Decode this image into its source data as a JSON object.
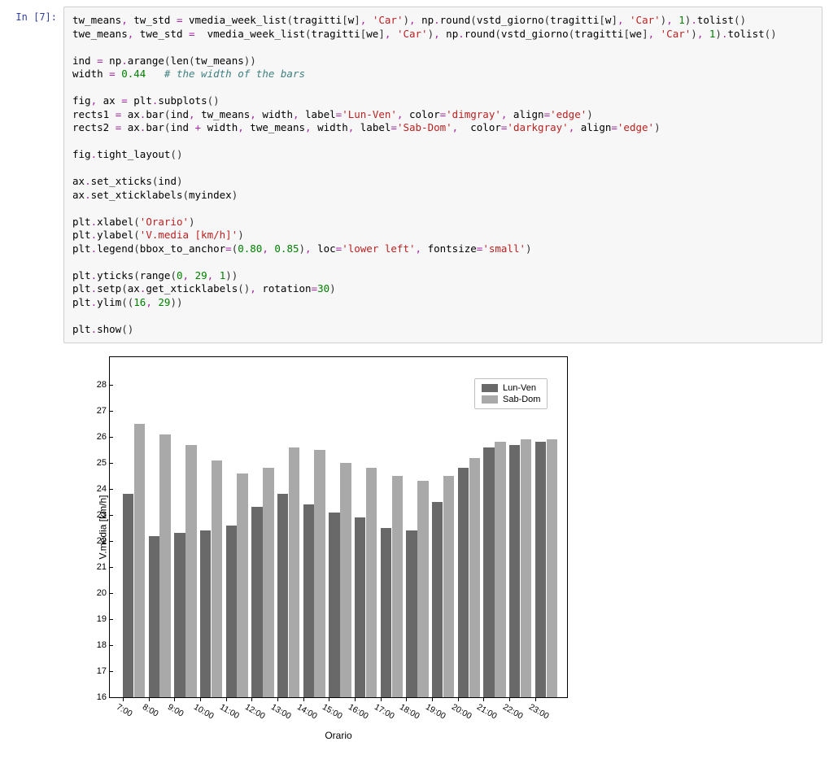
{
  "cell": {
    "prompt": "In [7]:",
    "code_html": "tw_means<span class=\"c-op\">,</span> tw_std <span class=\"c-op\">=</span> vmedia_week_list<span class=\"c-punct\">(</span>tragitti<span class=\"c-punct\">[</span>w<span class=\"c-punct\">]</span><span class=\"c-op\">,</span> <span class=\"c-str\">'Car'</span><span class=\"c-punct\">)</span><span class=\"c-op\">,</span> np<span class=\"c-op\">.</span>round<span class=\"c-punct\">(</span>vstd_giorno<span class=\"c-punct\">(</span>tragitti<span class=\"c-punct\">[</span>w<span class=\"c-punct\">]</span><span class=\"c-op\">,</span> <span class=\"c-str\">'Car'</span><span class=\"c-punct\">)</span><span class=\"c-op\">,</span> <span class=\"c-num\">1</span><span class=\"c-punct\">)</span><span class=\"c-op\">.</span>tolist<span class=\"c-punct\">()</span>\ntwe_means<span class=\"c-op\">,</span> twe_std <span class=\"c-op\">=</span>  vmedia_week_list<span class=\"c-punct\">(</span>tragitti<span class=\"c-punct\">[</span>we<span class=\"c-punct\">]</span><span class=\"c-op\">,</span> <span class=\"c-str\">'Car'</span><span class=\"c-punct\">)</span><span class=\"c-op\">,</span> np<span class=\"c-op\">.</span>round<span class=\"c-punct\">(</span>vstd_giorno<span class=\"c-punct\">(</span>tragitti<span class=\"c-punct\">[</span>we<span class=\"c-punct\">]</span><span class=\"c-op\">,</span> <span class=\"c-str\">'Car'</span><span class=\"c-punct\">)</span><span class=\"c-op\">,</span> <span class=\"c-num\">1</span><span class=\"c-punct\">)</span><span class=\"c-op\">.</span>tolist<span class=\"c-punct\">()</span>\n\nind <span class=\"c-op\">=</span> np<span class=\"c-op\">.</span>arange<span class=\"c-punct\">(</span>len<span class=\"c-punct\">(</span>tw_means<span class=\"c-punct\">))</span>\nwidth <span class=\"c-op\">=</span> <span class=\"c-num\">0.44</span>   <span class=\"c-com\"># the width of the bars</span>\n\nfig<span class=\"c-op\">,</span> ax <span class=\"c-op\">=</span> plt<span class=\"c-op\">.</span>subplots<span class=\"c-punct\">()</span>\nrects1 <span class=\"c-op\">=</span> ax<span class=\"c-op\">.</span>bar<span class=\"c-punct\">(</span>ind<span class=\"c-op\">,</span> tw_means<span class=\"c-op\">,</span> width<span class=\"c-op\">,</span> label<span class=\"c-op\">=</span><span class=\"c-str\">'Lun-Ven'</span><span class=\"c-op\">,</span> color<span class=\"c-op\">=</span><span class=\"c-str\">'dimgray'</span><span class=\"c-op\">,</span> align<span class=\"c-op\">=</span><span class=\"c-str\">'edge'</span><span class=\"c-punct\">)</span>\nrects2 <span class=\"c-op\">=</span> ax<span class=\"c-op\">.</span>bar<span class=\"c-punct\">(</span>ind <span class=\"c-op\">+</span> width<span class=\"c-op\">,</span> twe_means<span class=\"c-op\">,</span> width<span class=\"c-op\">,</span> label<span class=\"c-op\">=</span><span class=\"c-str\">'Sab-Dom'</span><span class=\"c-op\">,</span>  color<span class=\"c-op\">=</span><span class=\"c-str\">'darkgray'</span><span class=\"c-op\">,</span> align<span class=\"c-op\">=</span><span class=\"c-str\">'edge'</span><span class=\"c-punct\">)</span>\n\nfig<span class=\"c-op\">.</span>tight_layout<span class=\"c-punct\">()</span>\n\nax<span class=\"c-op\">.</span>set_xticks<span class=\"c-punct\">(</span>ind<span class=\"c-punct\">)</span>\nax<span class=\"c-op\">.</span>set_xticklabels<span class=\"c-punct\">(</span>myindex<span class=\"c-punct\">)</span>\n\nplt<span class=\"c-op\">.</span>xlabel<span class=\"c-punct\">(</span><span class=\"c-str\">'Orario'</span><span class=\"c-punct\">)</span>\nplt<span class=\"c-op\">.</span>ylabel<span class=\"c-punct\">(</span><span class=\"c-str\">'V.media [km/h]'</span><span class=\"c-punct\">)</span>\nplt<span class=\"c-op\">.</span>legend<span class=\"c-punct\">(</span>bbox_to_anchor<span class=\"c-op\">=</span><span class=\"c-punct\">(</span><span class=\"c-num\">0.80</span><span class=\"c-op\">,</span> <span class=\"c-num\">0.85</span><span class=\"c-punct\">)</span><span class=\"c-op\">,</span> loc<span class=\"c-op\">=</span><span class=\"c-str\">'lower left'</span><span class=\"c-op\">,</span> fontsize<span class=\"c-op\">=</span><span class=\"c-str\">'small'</span><span class=\"c-punct\">)</span>\n\nplt<span class=\"c-op\">.</span>yticks<span class=\"c-punct\">(</span>range<span class=\"c-punct\">(</span><span class=\"c-num\">0</span><span class=\"c-op\">,</span> <span class=\"c-num\">29</span><span class=\"c-op\">,</span> <span class=\"c-num\">1</span><span class=\"c-punct\">))</span>\nplt<span class=\"c-op\">.</span>setp<span class=\"c-punct\">(</span>ax<span class=\"c-op\">.</span>get_xticklabels<span class=\"c-punct\">()</span><span class=\"c-op\">,</span> rotation<span class=\"c-op\">=</span><span class=\"c-num\">30</span><span class=\"c-punct\">)</span>\nplt<span class=\"c-op\">.</span>ylim<span class=\"c-punct\">((</span><span class=\"c-num\">16</span><span class=\"c-op\">,</span> <span class=\"c-num\">29</span><span class=\"c-punct\">))</span>\n\nplt<span class=\"c-op\">.</span>show<span class=\"c-punct\">()</span>"
  },
  "chart_data": {
    "type": "bar",
    "xlabel": "Orario",
    "ylabel": "V.media [km/h]",
    "ylim": [
      16,
      29
    ],
    "yticks": [
      16,
      17,
      18,
      19,
      20,
      21,
      22,
      23,
      24,
      25,
      26,
      27,
      28
    ],
    "categories": [
      "7:00",
      "8:00",
      "9:00",
      "10:00",
      "11:00",
      "12:00",
      "13:00",
      "14:00",
      "15:00",
      "16:00",
      "17:00",
      "18:00",
      "19:00",
      "20:00",
      "21:00",
      "22:00",
      "23:00"
    ],
    "series": [
      {
        "name": "Lun-Ven",
        "color": "#696969",
        "values": [
          23.8,
          22.2,
          22.3,
          22.4,
          22.6,
          23.3,
          23.8,
          23.4,
          23.1,
          22.9,
          22.5,
          22.4,
          23.5,
          24.8,
          25.6,
          25.7,
          25.8
        ]
      },
      {
        "name": "Sab-Dom",
        "color": "#a9a9a9",
        "values": [
          26.5,
          26.1,
          25.7,
          25.1,
          24.6,
          24.8,
          25.6,
          25.5,
          25.0,
          24.8,
          24.5,
          24.3,
          24.5,
          25.2,
          25.8,
          25.9,
          25.9
        ]
      }
    ],
    "legend_pos": {
      "left_pct": 80,
      "bottom_pct": 85
    },
    "bar_width": 0.44
  }
}
